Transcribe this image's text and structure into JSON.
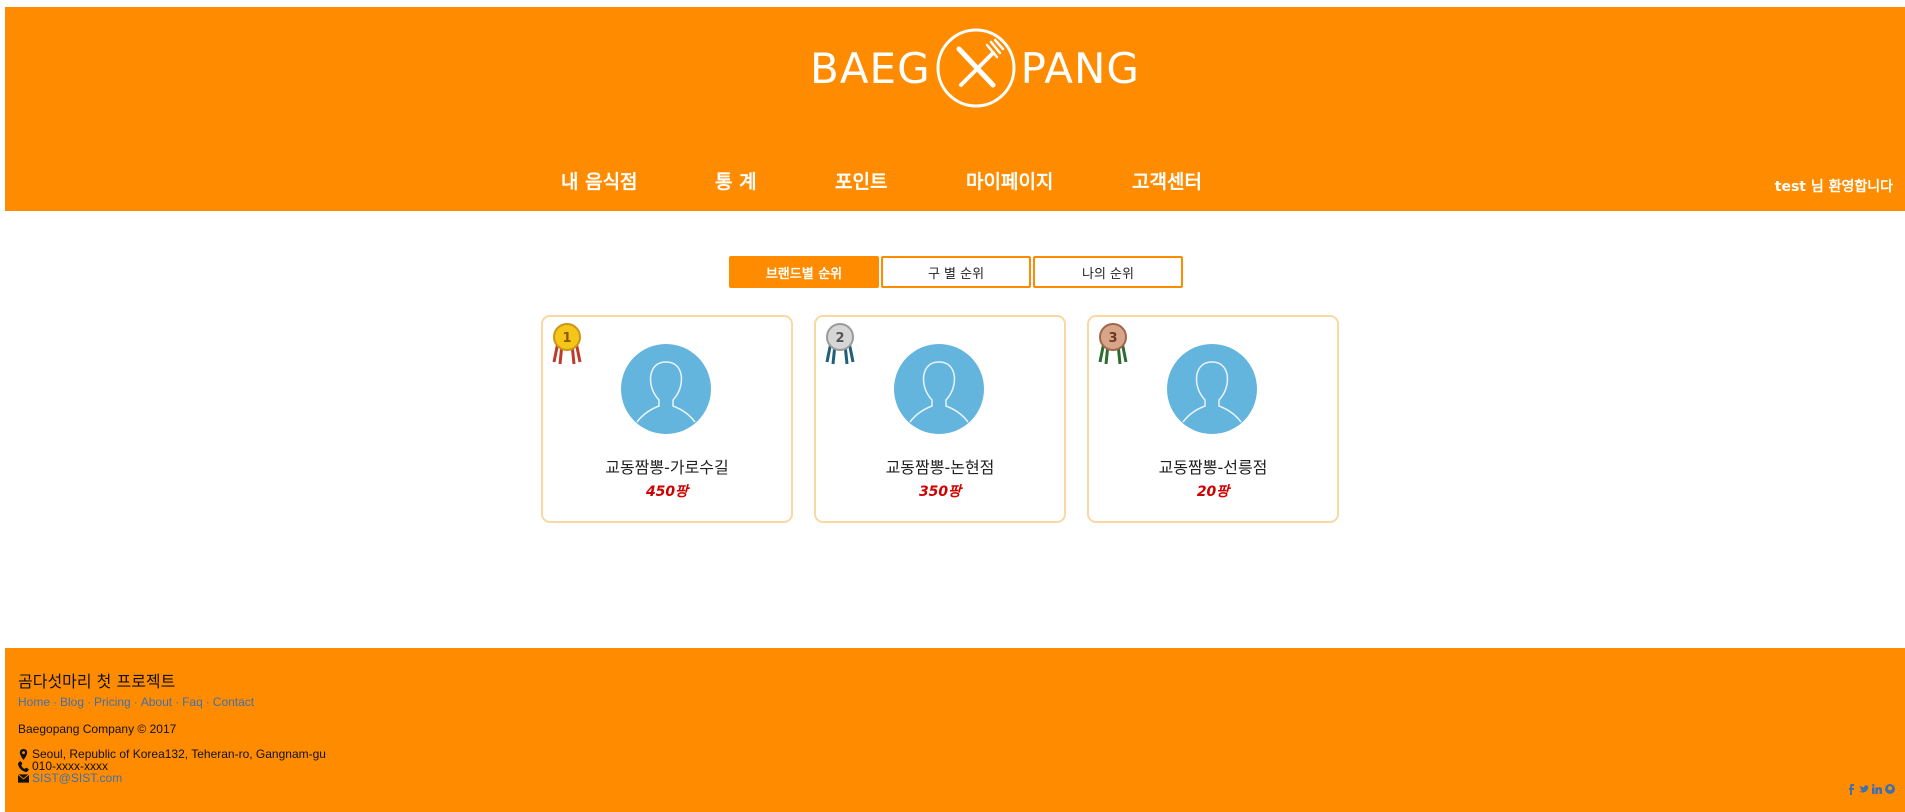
{
  "header": {
    "logo_left": "BAEG",
    "logo_right": "PANG",
    "nav": [
      "내 음식점",
      "통 계",
      "포인트",
      "마이페이지",
      "고객센터"
    ],
    "welcome": "test 님 환영합니다"
  },
  "tabs": [
    {
      "label": "브랜드별 순위",
      "active": true
    },
    {
      "label": "구 별 순위",
      "active": false
    },
    {
      "label": "나의 순위",
      "active": false
    }
  ],
  "ranking": [
    {
      "rank": 1,
      "name": "교동짬뽕-가로수길",
      "points": "450팡",
      "medal": "gold-medal-icon"
    },
    {
      "rank": 2,
      "name": "교동짬뽕-논현점",
      "points": "350팡",
      "medal": "silver-medal-icon"
    },
    {
      "rank": 3,
      "name": "교동짬뽕-선릉점",
      "points": "20팡",
      "medal": "bronze-medal-icon"
    }
  ],
  "footer": {
    "title": "곰다섯마리 첫 프로젝트",
    "links": [
      "Home",
      "Blog",
      "Pricing",
      "About",
      "Faq",
      "Contact"
    ],
    "copyright": "Baegopang Company © 2017",
    "address": "Seoul, Republic of Korea132, Teheran-ro, Gangnam-gu",
    "phone": "010-xxxx-xxxx",
    "email": "SIST@SIST.com",
    "social": [
      "facebook-icon",
      "twitter-icon",
      "linkedin-icon",
      "github-icon"
    ]
  },
  "colors": {
    "brand_orange": "#ff8c00",
    "card_border": "#f8d9a3",
    "avatar_blue": "#64b5dd",
    "points_red": "#d00000",
    "link_blue": "#3f6fb0"
  }
}
